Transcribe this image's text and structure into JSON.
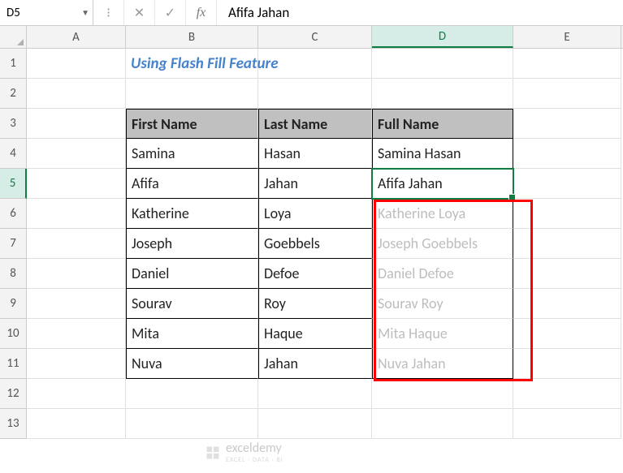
{
  "name_box": "D5",
  "formula_value": "Afifa Jahan",
  "columns": [
    "A",
    "B",
    "C",
    "D",
    "E"
  ],
  "active_col": "D",
  "active_row": 5,
  "title": "Using Flash Fill Feature",
  "headers": {
    "b": "First Name",
    "c": "Last Name",
    "d": "Full Name"
  },
  "rows": [
    {
      "b": "Samina",
      "c": "Hasan",
      "d": "Samina Hasan",
      "ghost": false
    },
    {
      "b": "Afifa",
      "c": "Jahan",
      "d": "Afifa Jahan",
      "ghost": false
    },
    {
      "b": "Katherine",
      "c": "Loya",
      "d": "Katherine Loya",
      "ghost": true
    },
    {
      "b": "Joseph",
      "c": "Goebbels",
      "d": "Joseph Goebbels",
      "ghost": true
    },
    {
      "b": "Daniel",
      "c": "Defoe",
      "d": "Daniel Defoe",
      "ghost": true
    },
    {
      "b": "Sourav",
      "c": "Roy",
      "d": "Sourav Roy",
      "ghost": true
    },
    {
      "b": "Mita",
      "c": "Haque",
      "d": "Mita Haque",
      "ghost": true
    },
    {
      "b": "Nuva",
      "c": "Jahan",
      "d": "Nuva Jahan",
      "ghost": true
    }
  ],
  "watermark": {
    "name": "exceldemy",
    "tagline": "EXCEL · DATA · BI"
  }
}
